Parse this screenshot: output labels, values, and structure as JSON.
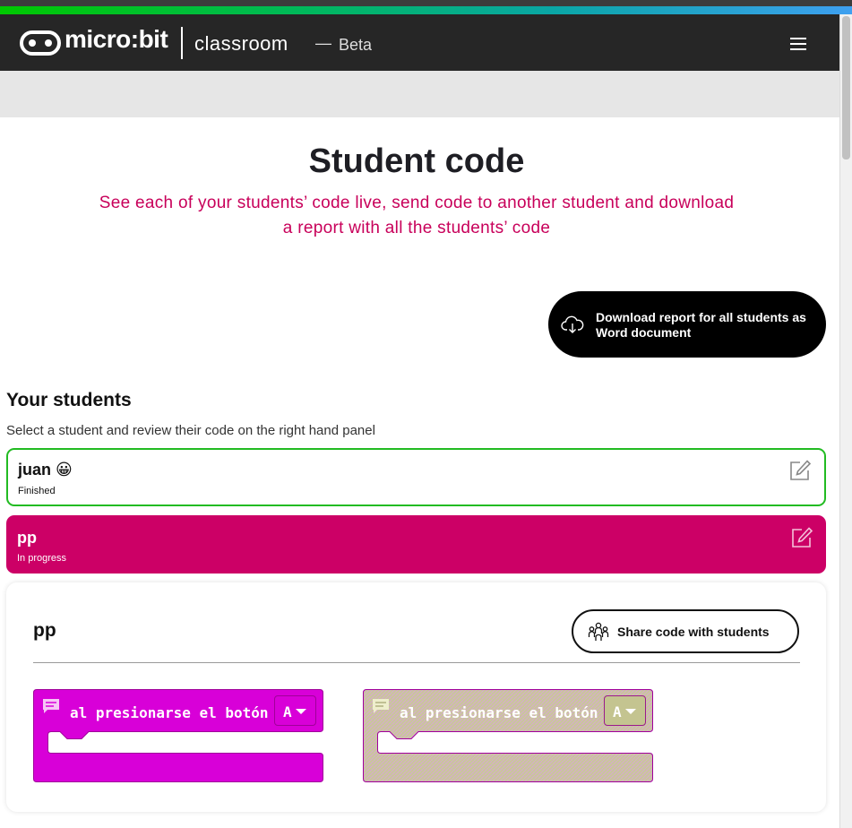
{
  "header": {
    "brand": "micro:bit",
    "product": "classroom",
    "separator": "—",
    "badge": "Beta"
  },
  "page": {
    "title": "Student code",
    "subtitle": "See each of your students’ code live, send code to another student and download a report with all the students’ code",
    "download_button": "Download report for all students as Word document"
  },
  "students": {
    "title": "Your students",
    "description": "Select a student and review their code on the right hand panel",
    "items": [
      {
        "name": "juan 😀",
        "status": "Finished"
      },
      {
        "name": "pp",
        "status": "In progress"
      }
    ]
  },
  "panel": {
    "student_name": "pp",
    "share_button": "Share code with students",
    "blocks": [
      {
        "label": "al presionarse el botón",
        "value": "A",
        "state": "active"
      },
      {
        "label": "al presionarse el botón",
        "value": "A",
        "state": "disabled"
      }
    ]
  },
  "colors": {
    "accent": "#cc0066",
    "finished_border": "#22bb22",
    "block_active": "#d800d8",
    "block_disabled": "#c4c490",
    "header_bg": "#262626"
  },
  "icons": {
    "menu": "hamburger-menu-icon",
    "download": "cloud-download-icon",
    "edit": "edit-pencil-icon",
    "share": "people-group-icon",
    "comment": "comment-icon"
  }
}
